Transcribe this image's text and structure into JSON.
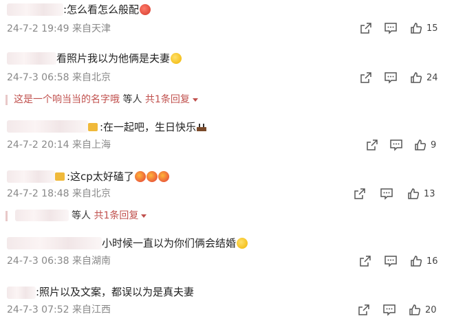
{
  "comments": [
    {
      "text": ":怎么看怎么般配",
      "meta": "24-7-2 19:49 来自天津",
      "likes": "15"
    },
    {
      "text": "看照片我以为他俩是夫妻",
      "meta": "24-7-3 06:58 来自北京",
      "likes": "24",
      "reply": {
        "name": "这是一个响当当的名字哦",
        "plain": "等人",
        "link": "共1条回复"
      }
    },
    {
      "text": ":在一起吧，生日快乐",
      "meta": "24-7-2 20:14 来自上海",
      "likes": "9"
    },
    {
      "text": ":这cp太好磕了",
      "meta": "24-7-2 18:48 来自北京",
      "likes": "13",
      "reply": {
        "name": "",
        "plain": "等人",
        "link": "共1条回复"
      }
    },
    {
      "text": "小时候一直以为你们俩会结婚",
      "meta": "24-7-3 06:38 来自湖南",
      "likes": "16"
    },
    {
      "text": ":照片以及文案，都误以为是真夫妻",
      "meta": "24-7-3 07:52 来自江西",
      "likes": "20"
    }
  ],
  "icons": {
    "share": "share-icon",
    "comment": "comment-icon",
    "like": "thumbs-up-icon"
  }
}
